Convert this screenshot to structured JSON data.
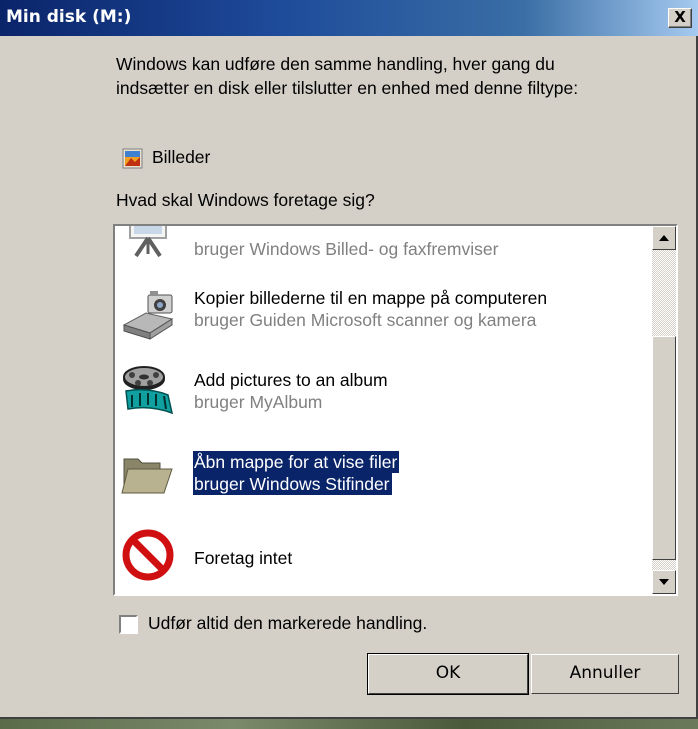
{
  "window": {
    "title": "Min disk (M:)",
    "close_label": "X"
  },
  "intro": {
    "line1": "Windows kan udføre den samme handling, hver gang du",
    "line2": "indsætter en disk eller tilslutter en enhed med denne filtype:"
  },
  "content_type": {
    "label": "Billeder",
    "icon": "pictures-icon"
  },
  "question": "Hvad skal Windows foretage sig?",
  "actions": [
    {
      "title": "",
      "subtitle": "bruger Windows Billed- og faxfremviser",
      "icon": "picture-viewer-icon",
      "selected": false
    },
    {
      "title": "Kopier billederne til en mappe på computeren",
      "subtitle": "bruger Guiden Microsoft scanner og kamera",
      "icon": "camera-scanner-icon",
      "selected": false
    },
    {
      "title": "Add pictures to an album",
      "subtitle": "bruger MyAlbum",
      "icon": "film-reel-icon",
      "selected": false
    },
    {
      "title": "Åbn mappe for at vise filer",
      "subtitle": "bruger Windows Stifinder",
      "icon": "folder-icon",
      "selected": true
    },
    {
      "title": "Foretag intet",
      "subtitle": "",
      "icon": "no-entry-icon",
      "selected": false
    }
  ],
  "always_checkbox": {
    "label": "Udfør altid den markerede handling.",
    "checked": false
  },
  "buttons": {
    "ok": "OK",
    "cancel": "Annuller"
  },
  "colors": {
    "title_bar": "#0a246a",
    "selection": "#0a246a",
    "dialog_bg": "#d4d0c8"
  }
}
